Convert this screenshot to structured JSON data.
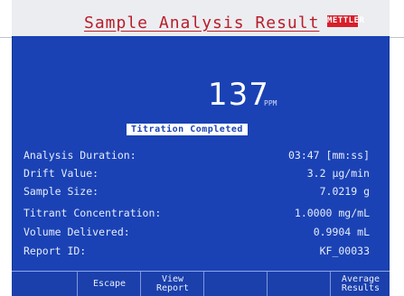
{
  "header": {
    "title": "Sample Analysis Result",
    "logo_text": "METTLER"
  },
  "result": {
    "value": "137",
    "unit": "PPM",
    "status": "Titration Completed"
  },
  "details": [
    {
      "label": "Analysis Duration:",
      "value": "03:47 [mm:ss]"
    },
    {
      "label": "Drift Value:",
      "value": "3.2 µg/min"
    },
    {
      "label": "Sample Size:",
      "value": "7.0219 g"
    },
    {
      "label": "Titrant Concentration:",
      "value": "1.0000 mg/mL"
    },
    {
      "label": "Volume Delivered:",
      "value": "0.9904 mL"
    },
    {
      "label": "Report ID:",
      "value": "KF_00033"
    }
  ],
  "softkeys": {
    "escape": "Escape",
    "view_report_1": "View",
    "view_report_2": "Report",
    "average_results_1": "Average",
    "average_results_2": "Results"
  },
  "colors": {
    "screen_bg": "#1a42b4",
    "title_text": "#b81d2a",
    "logo_bg": "#d81f2a"
  }
}
